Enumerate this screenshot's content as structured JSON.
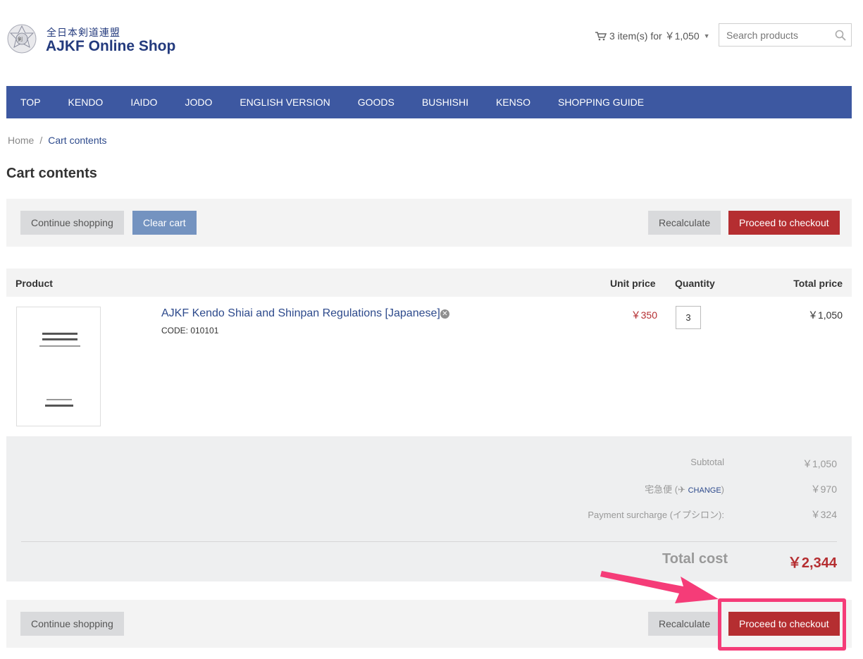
{
  "header": {
    "brand_jp": "全日本剣道連盟",
    "brand_en": "AJKF Online Shop",
    "cart_summary": "3 item(s) for ￥1,050",
    "search_placeholder": "Search products"
  },
  "nav": {
    "items": [
      "TOP",
      "KENDO",
      "IAIDO",
      "JODO",
      "ENGLISH VERSION",
      "GOODS",
      "BUSHISHI",
      "KENSO",
      "SHOPPING GUIDE"
    ]
  },
  "breadcrumb": {
    "home": "Home",
    "separator": "/",
    "current": "Cart contents"
  },
  "page_title": "Cart contents",
  "buttons": {
    "continue_shopping": "Continue shopping",
    "clear_cart": "Clear cart",
    "recalculate": "Recalculate",
    "proceed_to_checkout": "Proceed to checkout"
  },
  "table": {
    "headers": {
      "product": "Product",
      "unit_price": "Unit price",
      "quantity": "Quantity",
      "total_price": "Total price"
    },
    "rows": [
      {
        "name": "AJKF Kendo Shiai and Shinpan Regulations [Japanese]",
        "code": "CODE: 010101",
        "unit_price": "￥350",
        "quantity": "3",
        "total_price": "￥1,050"
      }
    ]
  },
  "totals": {
    "subtotal_label": "Subtotal",
    "subtotal_value": "￥1,050",
    "shipping_label_pre": "宅急便 (",
    "shipping_change": "CHANGE",
    "shipping_label_post": ")",
    "shipping_value": "￥970",
    "surcharge_label": "Payment surcharge (イプシロン):",
    "surcharge_value": "￥324",
    "total_label": "Total cost",
    "total_value": "￥2,344"
  },
  "colors": {
    "nav_bg": "#3d58a1",
    "brand": "#233a7d",
    "checkout_red": "#b52e31",
    "clear_blue": "#7493c0",
    "annotation_pink": "#f53c78"
  },
  "icons": {
    "logo": "ajkf-logo",
    "cart": "cart-icon",
    "search": "search-icon",
    "remove": "remove-icon",
    "plane": "plane-icon"
  }
}
